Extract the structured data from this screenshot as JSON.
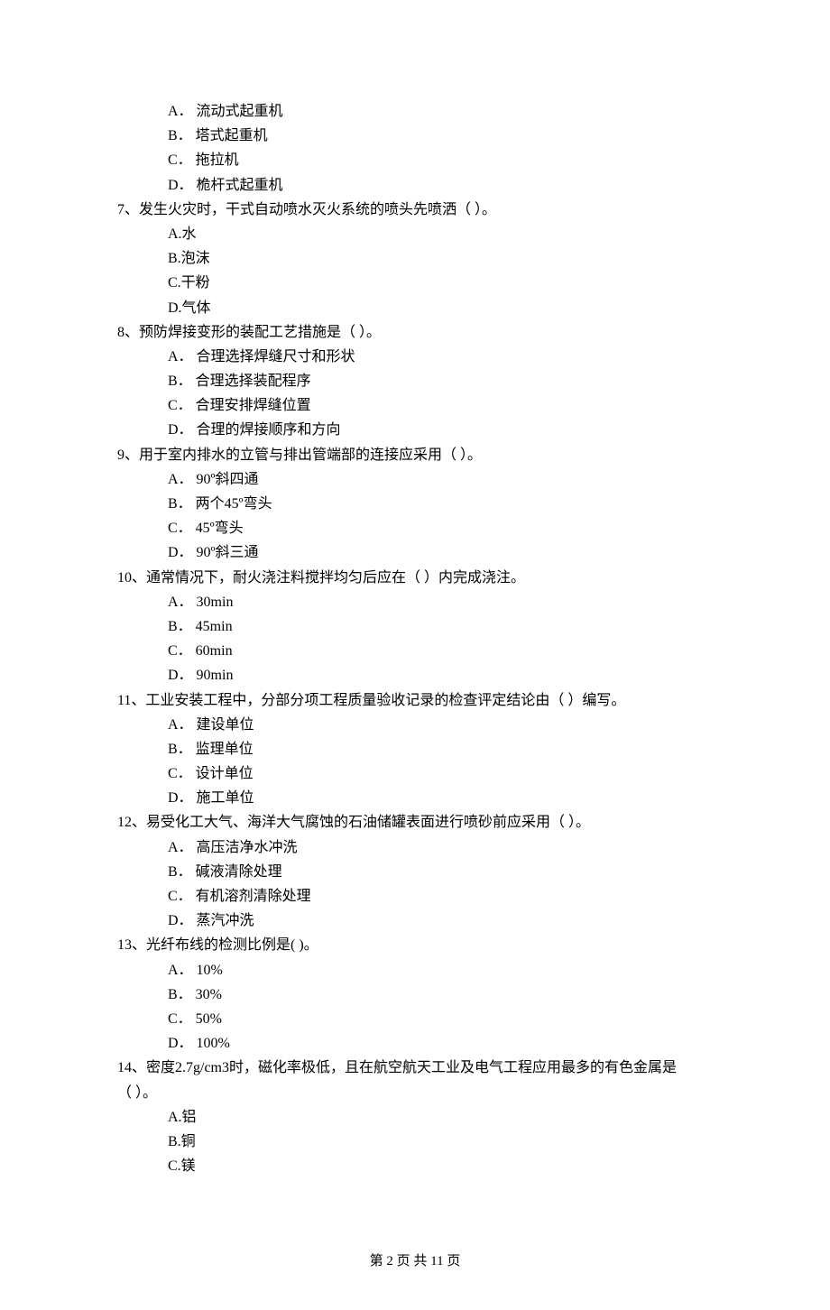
{
  "orphan_options": [
    "A． 流动式起重机",
    "B． 塔式起重机",
    "C． 拖拉机",
    "D． 桅杆式起重机"
  ],
  "questions": [
    {
      "stem": "7、发生火灾时，干式自动喷水灭火系统的喷头先喷洒（    ）。",
      "options": [
        "A.水",
        "B.泡沫",
        "C.干粉",
        "D.气体"
      ]
    },
    {
      "stem": "8、预防焊接变形的装配工艺措施是（    ）。",
      "options": [
        "A． 合理选择焊缝尺寸和形状",
        "B． 合理选择装配程序",
        "C． 合理安排焊缝位置",
        "D． 合理的焊接顺序和方向"
      ]
    },
    {
      "stem": "9、用于室内排水的立管与排出管端部的连接应采用（    ）。",
      "options": [
        "A． 90º斜四通",
        "B． 两个45º弯头",
        "C． 45º弯头",
        "D． 90º斜三通"
      ]
    },
    {
      "stem": "10、通常情况下，耐火浇注料搅拌均匀后应在（    ）内完成浇注。",
      "options": [
        "A． 30min",
        "B． 45min",
        "C． 60min",
        "D． 90min"
      ]
    },
    {
      "stem": "11、工业安装工程中，分部分项工程质量验收记录的检查评定结论由（    ）编写。",
      "options": [
        "A． 建设单位",
        "B． 监理单位",
        "C． 设计单位",
        "D． 施工单位"
      ]
    },
    {
      "stem": "12、易受化工大气、海洋大气腐蚀的石油储罐表面进行喷砂前应采用（    ）。",
      "options": [
        "A． 高压洁净水冲洗",
        "B． 碱液清除处理",
        "C． 有机溶剂清除处理",
        "D． 蒸汽冲洗"
      ]
    },
    {
      "stem": "13、光纤布线的检测比例是(    )。",
      "options": [
        "A． 10%",
        "B． 30%",
        "C． 50%",
        "D． 100%"
      ]
    },
    {
      "stem": "14、密度2.7g/cm3时，磁化率极低，且在航空航天工业及电气工程应用最多的有色金属是",
      "continuation": "（    ）。",
      "options": [
        "A.铝",
        "B.铜",
        "C.镁"
      ]
    }
  ],
  "footer": "第 2 页 共 11 页"
}
